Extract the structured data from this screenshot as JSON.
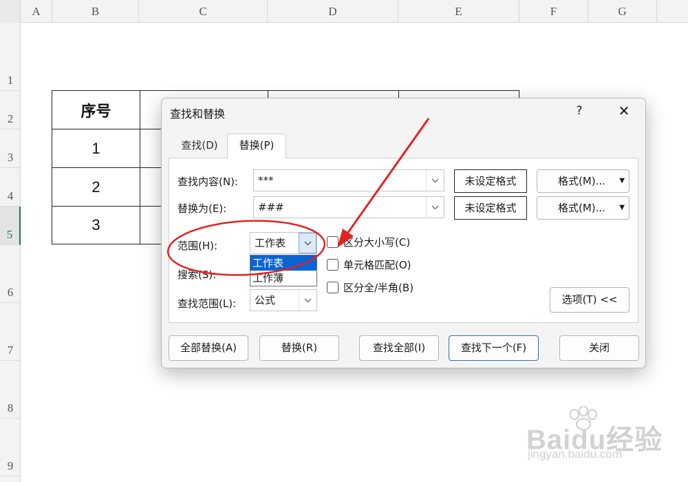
{
  "sheet": {
    "columns": [
      "A",
      "B",
      "C",
      "D",
      "E",
      "F",
      "G"
    ],
    "rows": [
      "1",
      "2",
      "3",
      "4",
      "5",
      "6",
      "7",
      "8",
      "9"
    ],
    "table": {
      "header": "序号",
      "values": [
        "1",
        "2",
        "3"
      ]
    }
  },
  "dialog": {
    "title": "查找和替换",
    "help": "?",
    "close": "✕",
    "tabs": {
      "find": "查找(D)",
      "replace": "替换(P)"
    },
    "find_label": "查找内容(N):",
    "find_value": "***",
    "replace_label": "替换为(E):",
    "replace_value": "###",
    "format_status": "未设定格式",
    "format_button": "格式(M)...",
    "scope_label": "范围(H):",
    "scope_value": "工作表",
    "scope_options": [
      "工作表",
      "工作薄"
    ],
    "search_label": "搜索(S):",
    "lookin_label": "查找范围(L):",
    "lookin_value": "公式",
    "checkboxes": [
      "区分大小写(C)",
      "单元格匹配(O)",
      "区分全/半角(B)"
    ],
    "options_button": "选项(T) <<",
    "buttons": {
      "replace_all": "全部替换(A)",
      "replace": "替换(R)",
      "find_all": "查找全部(I)",
      "find_next": "查找下一个(F)",
      "close": "关闭"
    }
  },
  "watermark": {
    "brand": "Baidu经验",
    "url": "jingyan.baidu.com"
  },
  "colors": {
    "annotation": "#e32222",
    "selection": "#0a64d2",
    "accent_border": "#2d6fc2",
    "active_row": "#217346"
  }
}
